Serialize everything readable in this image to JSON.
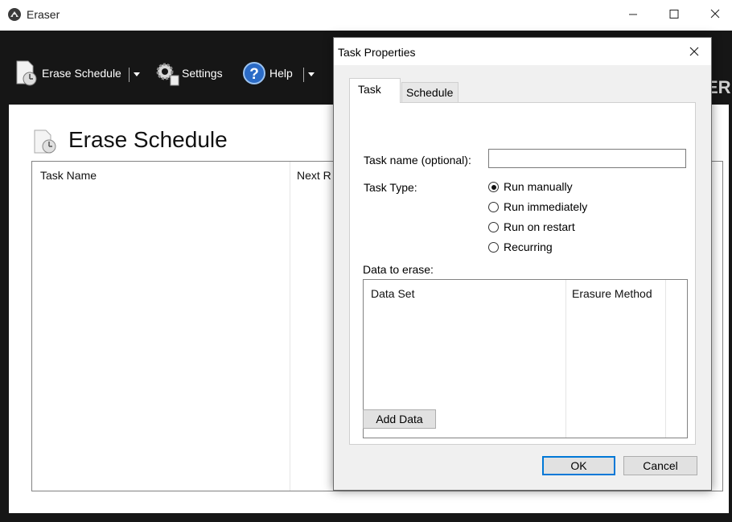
{
  "window": {
    "title": "Eraser",
    "controls": [
      "minimize",
      "maximize",
      "close"
    ]
  },
  "toolbar": {
    "erase_schedule_label": "Erase Schedule",
    "settings_label": "Settings",
    "help_label": "Help",
    "brand_fragment": "ER",
    "icons": [
      "schedule-icon",
      "gear-icon",
      "help-icon"
    ]
  },
  "main": {
    "page_title": "Erase Schedule",
    "list_columns": [
      "Task Name",
      "Next R"
    ]
  },
  "dialog": {
    "title": "Task Properties",
    "tabs": [
      {
        "label": "Task",
        "selected": true
      },
      {
        "label": "Schedule",
        "selected": false
      }
    ],
    "task_name_label": "Task name (optional):",
    "task_name_value": "",
    "task_type_label": "Task Type:",
    "task_types": [
      {
        "label": "Run manually",
        "checked": true
      },
      {
        "label": "Run immediately",
        "checked": false
      },
      {
        "label": "Run on restart",
        "checked": false
      },
      {
        "label": "Recurring",
        "checked": false
      }
    ],
    "data_to_erase_label": "Data to erase:",
    "data_columns": [
      "Data Set",
      "Erasure Method"
    ],
    "add_data_label": "Add Data",
    "ok_label": "OK",
    "cancel_label": "Cancel"
  },
  "colors": {
    "toolbar_bg": "#161616",
    "dialog_bg": "#f0f0f0",
    "default_button_border": "#0078d7"
  }
}
